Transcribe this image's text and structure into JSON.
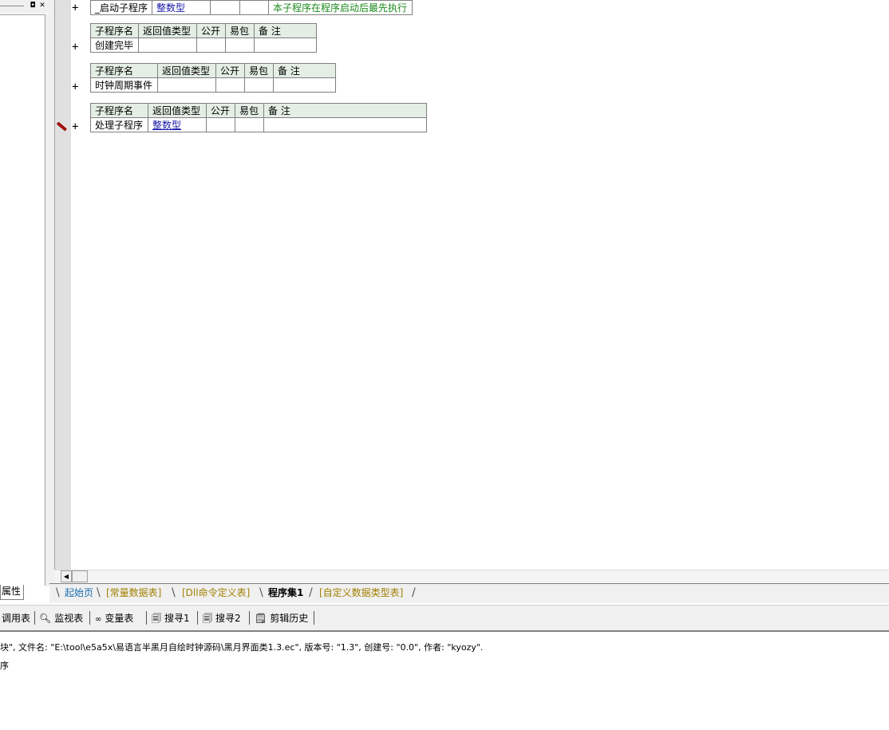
{
  "left_panel": {
    "restore_icon": "◘",
    "close_icon": "✕",
    "properties_tab": "属性"
  },
  "subroutine_tables": [
    {
      "rows": [
        [
          "_启动子程序",
          "整数型",
          "",
          "",
          "本子程序在程序启动后最先执行"
        ]
      ]
    },
    {
      "headers": [
        "子程序名",
        "返回值类型",
        "公开",
        "易包",
        "备 注"
      ],
      "rows": [
        [
          "创建完毕",
          "",
          "",
          "",
          ""
        ]
      ]
    },
    {
      "headers": [
        "子程序名",
        "返回值类型",
        "公开",
        "易包",
        "备 注"
      ],
      "rows": [
        [
          "时钟周期事件",
          "",
          "",
          "",
          ""
        ]
      ]
    },
    {
      "headers": [
        "子程序名",
        "返回值类型",
        "公开",
        "易包",
        "备 注"
      ],
      "rows": [
        [
          "处理子程序",
          "整数型",
          "",
          "",
          ""
        ]
      ]
    }
  ],
  "gutter": {
    "expand_symbol": "+"
  },
  "doc_tabs": [
    "起始页",
    "[常量数据表]",
    "[Dll命令定义表]",
    "程序集1",
    "[自定义数据类型表]"
  ],
  "active_doc_tab": "程序集1",
  "toolbar": {
    "call_table": "调用表",
    "watch_table": "监视表",
    "var_table": "变量表",
    "search1": "搜寻1",
    "search2": "搜寻2",
    "clip_history": "剪辑历史"
  },
  "output": {
    "line1": "块\", 文件名: \"E:\\tool\\e5a5x\\易语言半黑月自绘时钟源码\\黑月界面类1.3.ec\", 版本号: \"1.3\", 创建号: \"0.0\", 作者: \"kyozy\".",
    "line2": "序"
  },
  "colors": {
    "header_bg": "#e4eee4",
    "type_text": "#1a1aa8",
    "note_text": "#1c8a1c",
    "start_tab_text": "#1a6fb0",
    "inactive_tab_text": "#a08000"
  }
}
